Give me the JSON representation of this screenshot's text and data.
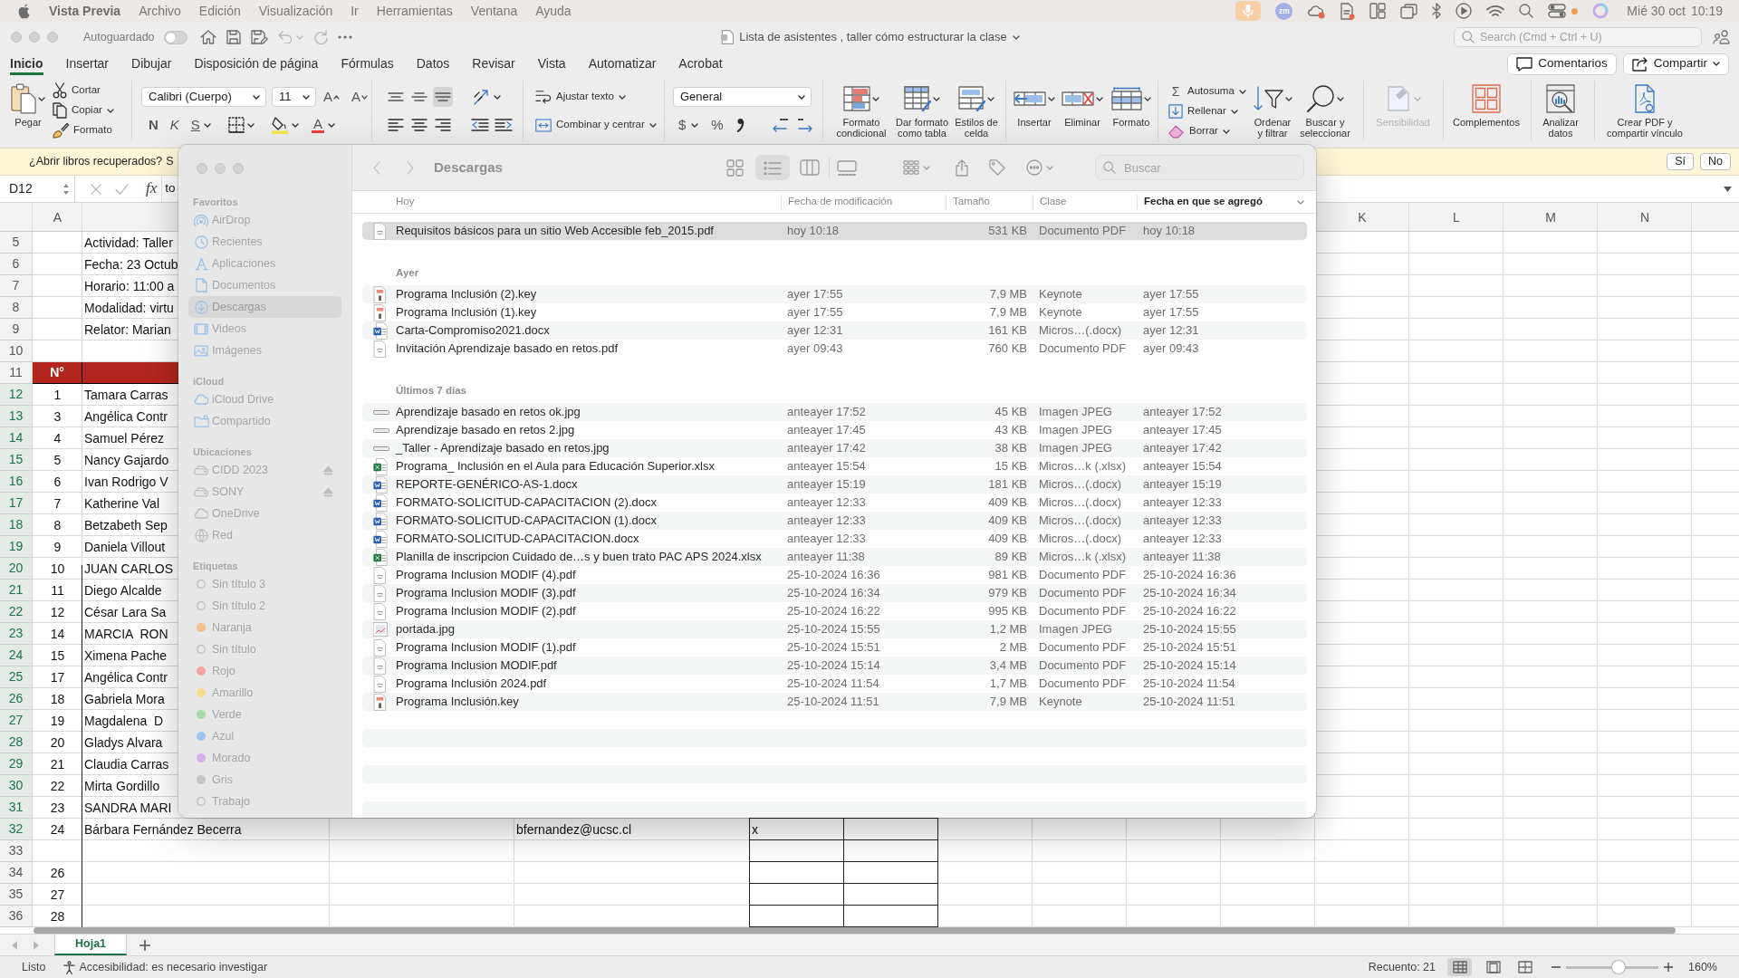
{
  "menu_bar": {
    "app_name": "Vista Previa",
    "menus": [
      "Archivo",
      "Edición",
      "Visualización",
      "Ir",
      "Herramientas",
      "Ventana",
      "Ayuda"
    ],
    "status_items": [
      {
        "kind": "mic"
      },
      {
        "kind": "badge",
        "text": "zm"
      },
      {
        "kind": "cloud"
      },
      {
        "kind": "document"
      },
      {
        "kind": "panels"
      },
      {
        "kind": "windows"
      },
      {
        "kind": "bluetooth"
      },
      {
        "kind": "play"
      },
      {
        "kind": "wifi"
      },
      {
        "kind": "search"
      },
      {
        "kind": "controls"
      },
      {
        "kind": "dot"
      },
      {
        "kind": "ring"
      }
    ],
    "date": "Mié 30 oct",
    "time": "10:19"
  },
  "excel": {
    "title_bar": {
      "autosave_label": "Autoguardado",
      "autosave_on": false,
      "title": "Lista de asistentes , taller cómo estructurar la clase",
      "search_placeholder": "Search (Cmd + Ctrl + U)"
    },
    "tabs": [
      {
        "label": "Inicio",
        "selected": true
      },
      {
        "label": "Insertar",
        "selected": false
      },
      {
        "label": "Dibujar",
        "selected": false
      },
      {
        "label": "Disposición de página",
        "selected": false
      },
      {
        "label": "Fórmulas",
        "selected": false
      },
      {
        "label": "Datos",
        "selected": false
      },
      {
        "label": "Revisar",
        "selected": false
      },
      {
        "label": "Vista",
        "selected": false
      },
      {
        "label": "Automatizar",
        "selected": false
      },
      {
        "label": "Acrobat",
        "selected": false
      }
    ],
    "comments_button": "Comentarios",
    "share_button": "Compartir",
    "ribbon": {
      "paste": "Pegar",
      "clipboard": [
        {
          "kind": "cut",
          "label": "Cortar"
        },
        {
          "kind": "copy",
          "label": "Copiar"
        },
        {
          "kind": "brush",
          "label": "Formato"
        }
      ],
      "font": "Calibri (Cuerpo)",
      "font_size": "11",
      "grow_font": "A",
      "shrink_font": "A",
      "styles": [
        {
          "kind": "bold",
          "label": "N"
        },
        {
          "kind": "italic",
          "label": "K"
        },
        {
          "kind": "underline",
          "label": "S"
        }
      ],
      "font_color": "A",
      "vertical_align": [
        {
          "kind": "top",
          "selected": false
        },
        {
          "kind": "middle",
          "selected": false
        },
        {
          "kind": "bottom",
          "selected": true
        }
      ],
      "wrap_text": "Ajustar texto",
      "merge": "Combinar y centrar",
      "number_format": "General",
      "currency": "$",
      "percent": "%",
      "style_buttons": [
        {
          "kind": "conditional",
          "label": "Formato condicional"
        },
        {
          "kind": "table",
          "label": "Dar formato como tabla"
        },
        {
          "kind": "cellstyles",
          "label": "Estilos de celda"
        }
      ],
      "cell_buttons": [
        {
          "kind": "insert",
          "label": "Insertar"
        },
        {
          "kind": "delete",
          "label": "Eliminar"
        },
        {
          "kind": "format",
          "label": "Formato"
        }
      ],
      "editing": [
        {
          "kind": "sum",
          "symbol": "Σ",
          "label": "Autosuma"
        },
        {
          "kind": "fill",
          "label": "Rellenar"
        },
        {
          "kind": "clear",
          "label": "Borrar"
        }
      ],
      "find_buttons": [
        {
          "kind": "sort",
          "label": "Ordenar y filtrar"
        },
        {
          "kind": "find",
          "label": "Buscar y seleccionar"
        }
      ],
      "extra_buttons": [
        {
          "kind": "sensitivity",
          "label": "Sensibilidad",
          "disabled": true
        },
        {
          "kind": "addins",
          "label": "Complementos",
          "disabled": false
        },
        {
          "kind": "analyze",
          "label": "Analizar datos",
          "disabled": false
        },
        {
          "kind": "pdf",
          "label": "Crear PDF y compartir vínculo",
          "disabled": false
        }
      ]
    },
    "recovery_bar": {
      "message": "¿Abrir libros recuperados?",
      "detail": "S",
      "buttons": [
        "Sí",
        "No"
      ]
    },
    "formula_bar": {
      "cell": "D12",
      "function_label": "fx",
      "content": "to"
    },
    "sheet": {
      "column_headers": {
        "column_1": "A",
        "column_11": "K",
        "column_12": "L",
        "column_13": "M",
        "column_14": "N"
      },
      "rows": [
        {
          "number": "5",
          "selected": false,
          "kind": "info",
          "cells": {
            "column_2": "Actividad: Taller"
          }
        },
        {
          "number": "6",
          "selected": false,
          "kind": "info",
          "cells": {
            "column_2": "Fecha: 23 Octub"
          }
        },
        {
          "number": "7",
          "selected": false,
          "kind": "info",
          "cells": {
            "column_2": "Horario: 11:00 a"
          }
        },
        {
          "number": "8",
          "selected": false,
          "kind": "info",
          "cells": {
            "column_2": "Modalidad: virtu"
          }
        },
        {
          "number": "9",
          "selected": false,
          "kind": "info",
          "cells": {
            "column_2": "Relator: Marian"
          }
        },
        {
          "number": "10",
          "selected": false,
          "kind": "info"
        },
        {
          "number": "11",
          "selected": false,
          "kind": "header",
          "cells": {
            "column_1": "N°"
          }
        },
        {
          "number": "12",
          "selected": true,
          "kind": "data",
          "cells": {
            "column_1": "1",
            "column_2": "Tamara Carras"
          }
        },
        {
          "number": "13",
          "selected": true,
          "kind": "data",
          "cells": {
            "column_1": "3",
            "column_2": "Angélica Contr"
          }
        },
        {
          "number": "14",
          "selected": true,
          "kind": "data",
          "cells": {
            "column_1": "4",
            "column_2": "Samuel Pérez"
          }
        },
        {
          "number": "15",
          "selected": true,
          "kind": "data",
          "cells": {
            "column_1": "5",
            "column_2": "Nancy Gajardo"
          }
        },
        {
          "number": "16",
          "selected": true,
          "kind": "data",
          "cells": {
            "column_1": "6",
            "column_2": "Ivan Rodrigo V"
          }
        },
        {
          "number": "17",
          "selected": true,
          "kind": "data",
          "cells": {
            "column_1": "7",
            "column_2": "Katherine Val"
          }
        },
        {
          "number": "18",
          "selected": true,
          "kind": "data",
          "cells": {
            "column_1": "8",
            "column_2": "Betzabeth Sep"
          }
        },
        {
          "number": "19",
          "selected": true,
          "kind": "data",
          "cells": {
            "column_1": "9",
            "column_2": "Daniela Villout"
          }
        },
        {
          "number": "20",
          "selected": true,
          "kind": "data",
          "cells": {
            "column_1": "10",
            "column_2": "JUAN CARLOS"
          }
        },
        {
          "number": "21",
          "selected": true,
          "kind": "data",
          "cells": {
            "column_1": "11",
            "column_2": "Diego Alcalde"
          }
        },
        {
          "number": "22",
          "selected": true,
          "kind": "data",
          "cells": {
            "column_1": "12",
            "column_2": "César Lara Sa"
          }
        },
        {
          "number": "23",
          "selected": true,
          "kind": "data",
          "cells": {
            "column_1": "14",
            "column_2": "MARCIA  RON"
          }
        },
        {
          "number": "24",
          "selected": true,
          "kind": "data",
          "cells": {
            "column_1": "15",
            "column_2": "Ximena Pache"
          }
        },
        {
          "number": "25",
          "selected": true,
          "kind": "data",
          "cells": {
            "column_1": "17",
            "column_2": "Angélica Contr"
          }
        },
        {
          "number": "26",
          "selected": true,
          "kind": "data",
          "cells": {
            "column_1": "18",
            "column_2": "Gabriela Mora"
          }
        },
        {
          "number": "27",
          "selected": true,
          "kind": "data",
          "cells": {
            "column_1": "19",
            "column_2": "Magdalena  D"
          }
        },
        {
          "number": "28",
          "selected": true,
          "kind": "data",
          "cells": {
            "column_1": "20",
            "column_2": "Gladys Alvara"
          }
        },
        {
          "number": "29",
          "selected": true,
          "kind": "data",
          "cells": {
            "column_1": "21",
            "column_2": "Claudia Carras"
          }
        },
        {
          "number": "30",
          "selected": true,
          "kind": "data",
          "cells": {
            "column_1": "22",
            "column_2": "Mirta Gordillo"
          }
        },
        {
          "number": "31",
          "selected": true,
          "kind": "data",
          "cells": {
            "column_1": "23",
            "column_2": "SANDRA MARI"
          }
        },
        {
          "number": "32",
          "selected": true,
          "kind": "data",
          "cells": {
            "column_1": "24",
            "column_2": "Bárbara Fernández Becerra",
            "column_4": "bfernandez@ucsc.cl",
            "column_5": "x"
          }
        },
        {
          "number": "33",
          "selected": false,
          "kind": "data"
        },
        {
          "number": "34",
          "selected": false,
          "kind": "data",
          "cells": {
            "column_1": "26"
          }
        },
        {
          "number": "35",
          "selected": false,
          "kind": "data",
          "cells": {
            "column_1": "27"
          }
        },
        {
          "number": "36",
          "selected": false,
          "kind": "data",
          "cells": {
            "column_1": "28"
          }
        }
      ]
    },
    "sheet_tabs": [
      {
        "label": "Hoja1",
        "selected": true
      }
    ],
    "status_bar": {
      "ready": "Listo",
      "accessibility": "Accesibilidad: es necesario investigar",
      "count": "Recuento: 21",
      "views": [
        {
          "kind": "normal",
          "selected": true
        },
        {
          "kind": "layout",
          "selected": false
        },
        {
          "kind": "break",
          "selected": false
        }
      ],
      "zoom": {
        "level": 0.57,
        "reading": "160%"
      }
    }
  },
  "finder": {
    "title": "Descargas",
    "views": [
      {
        "kind": "icons",
        "selected": false
      },
      {
        "kind": "list",
        "selected": true
      },
      {
        "kind": "columns",
        "selected": false
      },
      {
        "kind": "gallery",
        "selected": false
      }
    ],
    "search_placeholder": "Buscar",
    "sidebar": [
      {
        "label": "Favoritos",
        "items": [
          {
            "kind": "airdrop",
            "label": "AirDrop",
            "selected": false
          },
          {
            "kind": "clock",
            "label": "Recientes",
            "selected": false
          },
          {
            "kind": "apps",
            "label": "Aplicaciones",
            "selected": false
          },
          {
            "kind": "document",
            "label": "Documentos",
            "selected": false
          },
          {
            "kind": "download",
            "label": "Descargas",
            "selected": true
          },
          {
            "kind": "film",
            "label": "Videos",
            "selected": false
          },
          {
            "kind": "photo",
            "label": "Imágenes",
            "selected": false
          }
        ]
      },
      {
        "label": "iCloud",
        "items": [
          {
            "kind": "cloud",
            "label": "iCloud Drive",
            "selected": false
          },
          {
            "kind": "shared",
            "label": "Compartido",
            "selected": false
          }
        ]
      },
      {
        "label": "Ubicaciones",
        "items": [
          {
            "kind": "drive",
            "label": "CIDD 2023",
            "selected": false,
            "ejectable": true
          },
          {
            "kind": "drive",
            "label": "SONY",
            "selected": false,
            "ejectable": true
          },
          {
            "kind": "cloud",
            "label": "OneDrive",
            "selected": false,
            "ejectable": false
          },
          {
            "kind": "globe",
            "label": "Red",
            "selected": false,
            "ejectable": false
          }
        ]
      },
      {
        "label": "Etiquetas",
        "items": [
          {
            "kind": "tag",
            "label": "Sin título 3",
            "selected": false
          },
          {
            "kind": "tag",
            "label": "Sin título 2",
            "selected": false
          },
          {
            "kind": "tag",
            "label": "Naranja",
            "selected": false,
            "color": "#f4c08c"
          },
          {
            "kind": "tag",
            "label": "Sin título",
            "selected": false
          },
          {
            "kind": "tag",
            "label": "Rojo",
            "selected": false,
            "color": "#f2a3a2"
          },
          {
            "kind": "tag",
            "label": "Amarillo",
            "selected": false,
            "color": "#f4dc8c"
          },
          {
            "kind": "tag",
            "label": "Verde",
            "selected": false,
            "color": "#a7dba8"
          },
          {
            "kind": "tag",
            "label": "Azul",
            "selected": false,
            "color": "#9dc5ef"
          },
          {
            "kind": "tag",
            "label": "Morado",
            "selected": false,
            "color": "#d3aee8"
          },
          {
            "kind": "tag",
            "label": "Gris",
            "selected": false,
            "color": "#c4c4c4"
          },
          {
            "kind": "tag",
            "label": "Trabajo",
            "selected": false
          }
        ]
      }
    ],
    "columns": [
      {
        "label": "Fecha de modificación",
        "sorted": false
      },
      {
        "label": "Tamaño",
        "sorted": false
      },
      {
        "label": "Clase",
        "sorted": false
      },
      {
        "label": "Fecha en que se agregó",
        "sorted": true
      }
    ],
    "groups": [
      {
        "label": "Hoy",
        "files": [
          {
            "kind": "pdf",
            "name": "Requisitos básicos para un sitio Web Accesible feb_2015.pdf",
            "modified": "hoy 10:18",
            "size": "531 KB",
            "type": "Documento PDF",
            "added": "hoy 10:18",
            "selected": true
          }
        ]
      },
      {
        "label": "Ayer",
        "files": [
          {
            "kind": "keynote",
            "name": "Programa Inclusión (2).key",
            "modified": "ayer 17:55",
            "size": "7,9 MB",
            "type": "Keynote",
            "added": "ayer 17:55",
            "selected": false
          },
          {
            "kind": "keynote",
            "name": "Programa Inclusión (1).key",
            "modified": "ayer 17:55",
            "size": "7,9 MB",
            "type": "Keynote",
            "added": "ayer 17:55",
            "selected": false
          },
          {
            "kind": "word",
            "name": "Carta-Compromiso2021.docx",
            "modified": "ayer 12:31",
            "size": "161 KB",
            "type": "Micros…(.docx)",
            "added": "ayer 12:31",
            "selected": false
          },
          {
            "kind": "pdf",
            "name": "Invitación Aprendizaje basado en retos.pdf",
            "modified": "ayer 09:43",
            "size": "760 KB",
            "type": "Documento PDF",
            "added": "ayer 09:43",
            "selected": false
          }
        ]
      },
      {
        "label": "Últimos 7 días",
        "files": [
          {
            "kind": "strip",
            "name": "Aprendizaje basado en retos ok.jpg",
            "modified": "anteayer 17:52",
            "size": "45 KB",
            "type": "Imagen JPEG",
            "added": "anteayer 17:52",
            "selected": false
          },
          {
            "kind": "strip",
            "name": "Aprendizaje basado en retos 2.jpg",
            "modified": "anteayer 17:45",
            "size": "43 KB",
            "type": "Imagen JPEG",
            "added": "anteayer 17:45",
            "selected": false
          },
          {
            "kind": "strip",
            "name": "_Taller - Aprendizaje basado en retos.jpg",
            "modified": "anteayer 17:42",
            "size": "38 KB",
            "type": "Imagen JPEG",
            "added": "anteayer 17:42",
            "selected": false
          },
          {
            "kind": "excel",
            "name": "Programa_ Inclusión en el Aula para Educación Superior.xlsx",
            "modified": "anteayer 15:54",
            "size": "15 KB",
            "type": "Micros…k (.xlsx)",
            "added": "anteayer 15:54",
            "selected": false
          },
          {
            "kind": "word",
            "name": "REPORTE-GENÉRICO-AS-1.docx",
            "modified": "anteayer 15:19",
            "size": "181 KB",
            "type": "Micros…(.docx)",
            "added": "anteayer 15:19",
            "selected": false
          },
          {
            "kind": "word",
            "name": "FORMATO-SOLICITUD-CAPACITACION (2).docx",
            "modified": "anteayer 12:33",
            "size": "409 KB",
            "type": "Micros…(.docx)",
            "added": "anteayer 12:33",
            "selected": false
          },
          {
            "kind": "word",
            "name": "FORMATO-SOLICITUD-CAPACITACION (1).docx",
            "modified": "anteayer 12:33",
            "size": "409 KB",
            "type": "Micros…(.docx)",
            "added": "anteayer 12:33",
            "selected": false
          },
          {
            "kind": "word",
            "name": "FORMATO-SOLICITUD-CAPACITACION.docx",
            "modified": "anteayer 12:33",
            "size": "409 KB",
            "type": "Micros…(.docx)",
            "added": "anteayer 12:33",
            "selected": false
          },
          {
            "kind": "excel",
            "name": "Planilla de inscripcion Cuidado de…s y buen trato PAC APS 2024.xlsx",
            "modified": "anteayer 11:38",
            "size": "89 KB",
            "type": "Micros…k (.xlsx)",
            "added": "anteayer 11:38",
            "selected": false
          },
          {
            "kind": "pdf",
            "name": "Programa Inclusion MODIF (4).pdf",
            "modified": "25-10-2024 16:36",
            "size": "981 KB",
            "type": "Documento PDF",
            "added": "25-10-2024 16:36",
            "selected": false
          },
          {
            "kind": "pdf",
            "name": "Programa Inclusion MODIF (3).pdf",
            "modified": "25-10-2024 16:34",
            "size": "979 KB",
            "type": "Documento PDF",
            "added": "25-10-2024 16:34",
            "selected": false
          },
          {
            "kind": "pdf",
            "name": "Programa Inclusion MODIF (2).pdf",
            "modified": "25-10-2024 16:22",
            "size": "995 KB",
            "type": "Documento PDF",
            "added": "25-10-2024 16:22",
            "selected": false
          },
          {
            "kind": "image",
            "name": "portada.jpg",
            "modified": "25-10-2024 15:55",
            "size": "1,2 MB",
            "type": "Imagen JPEG",
            "added": "25-10-2024 15:55",
            "selected": false
          },
          {
            "kind": "pdf",
            "name": "Programa Inclusion MODIF (1).pdf",
            "modified": "25-10-2024 15:51",
            "size": "2 MB",
            "type": "Documento PDF",
            "added": "25-10-2024 15:51",
            "selected": false
          },
          {
            "kind": "pdf",
            "name": "Programa Inclusion MODIF.pdf",
            "modified": "25-10-2024 15:14",
            "size": "3,4 MB",
            "type": "Documento PDF",
            "added": "25-10-2024 15:14",
            "selected": false
          },
          {
            "kind": "pdf",
            "name": "Programa Inclusión 2024.pdf",
            "modified": "25-10-2024 11:54",
            "size": "1,7 MB",
            "type": "Documento PDF",
            "added": "25-10-2024 11:54",
            "selected": false
          },
          {
            "kind": "keynote",
            "name": "Programa Inclusión.key",
            "modified": "25-10-2024 11:51",
            "size": "7,9 MB",
            "type": "Keynote",
            "added": "25-10-2024 11:51",
            "selected": false
          }
        ]
      }
    ]
  }
}
